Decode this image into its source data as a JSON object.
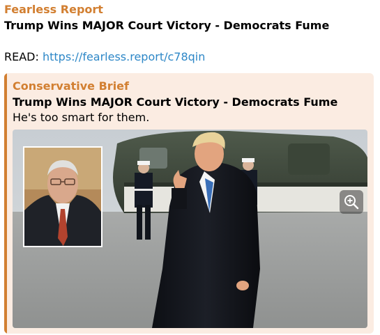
{
  "message": {
    "sender": "Fearless Report",
    "title": "Trump Wins MAJOR Court Victory - Democrats Fume",
    "read_prefix": "READ: ",
    "read_link": "https://fearless.report/c78qin"
  },
  "preview": {
    "site_name": "Conservative Brief",
    "title": "Trump Wins MAJOR Court Victory - Democrats Fume",
    "description": "He's too smart for them."
  },
  "colors": {
    "accent": "#d27f31",
    "link": "#2d87c7",
    "preview_background": "#fbece2"
  },
  "icons": {
    "zoom": "zoom-in-icon"
  }
}
